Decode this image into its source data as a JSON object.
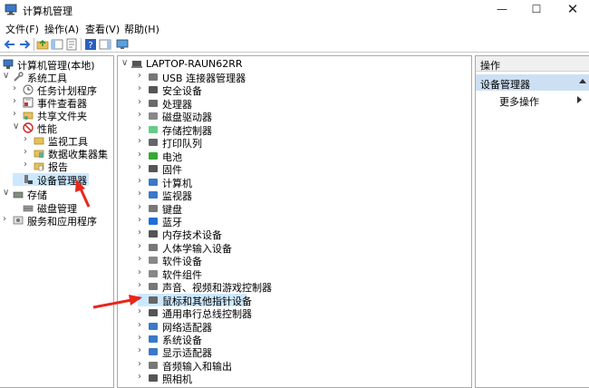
{
  "window": {
    "title": "计算机管理",
    "minimize": "—",
    "maximize": "☐",
    "close": "✕"
  },
  "menu": [
    "文件(F)",
    "操作(A)",
    "查看(V)",
    "帮助(H)"
  ],
  "left_tree": [
    {
      "label": "计算机管理(本地)",
      "arrow": "",
      "icon": "computer-management-icon"
    },
    {
      "label": "系统工具",
      "arrow": "∨",
      "icon": "tools-icon"
    },
    {
      "label": "任务计划程序",
      "arrow": "›",
      "icon": "clock-icon"
    },
    {
      "label": "事件查看器",
      "arrow": "›",
      "icon": "event-viewer-icon"
    },
    {
      "label": "共享文件夹",
      "arrow": "›",
      "icon": "shared-folder-icon"
    },
    {
      "label": "性能",
      "arrow": "∨",
      "icon": "performance-icon"
    },
    {
      "label": "监视工具",
      "arrow": "›",
      "icon": "monitor-tool-icon"
    },
    {
      "label": "数据收集器集",
      "arrow": "›",
      "icon": "data-collector-icon"
    },
    {
      "label": "报告",
      "arrow": "›",
      "icon": "report-icon"
    },
    {
      "label": "设备管理器",
      "arrow": "",
      "icon": "device-manager-icon"
    },
    {
      "label": "存储",
      "arrow": "∨",
      "icon": "storage-icon"
    },
    {
      "label": "磁盘管理",
      "arrow": "",
      "icon": "disk-management-icon"
    },
    {
      "label": "服务和应用程序",
      "arrow": "›",
      "icon": "services-icon"
    }
  ],
  "device_tree": {
    "root": "LAPTOP-RAUN62RR",
    "root_arrow": "∨",
    "child_arrow": "›",
    "items": [
      "USB 连接器管理器",
      "安全设备",
      "处理器",
      "磁盘驱动器",
      "存储控制器",
      "打印队列",
      "电池",
      "固件",
      "计算机",
      "监视器",
      "键盘",
      "蓝牙",
      "内存技术设备",
      "人体学输入设备",
      "软件设备",
      "软件组件",
      "声音、视频和游戏控制器",
      "鼠标和其他指针设备",
      "通用串行总线控制器",
      "网络适配器",
      "系统设备",
      "显示适配器",
      "音频输入和输出",
      "照相机"
    ]
  },
  "actions": {
    "header": "操作",
    "section": "设备管理器",
    "more": "更多操作"
  },
  "colors": {
    "selection": "#cce8ff",
    "action_section": "#cde0f3",
    "annotation_arrow": "#e8261c"
  }
}
